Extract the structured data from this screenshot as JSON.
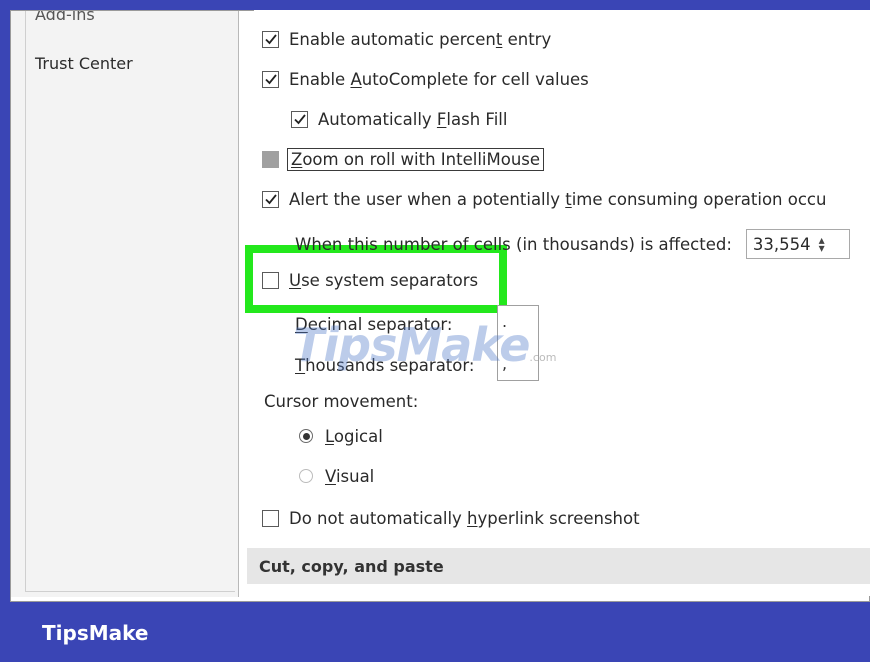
{
  "sidebar": {
    "items": [
      {
        "label": "Add-ins"
      },
      {
        "label": "Trust Center"
      }
    ]
  },
  "options": {
    "percent_entry": {
      "pre": "Enable automatic percen",
      "u": "t",
      "post": " entry",
      "checked": true
    },
    "autocomplete": {
      "pre": "Enable ",
      "u": "A",
      "post": "utoComplete for cell values",
      "checked": true
    },
    "flash_fill": {
      "pre": "Automatically ",
      "u": "F",
      "post": "lash Fill",
      "checked": true
    },
    "zoom_roll": {
      "pre": "",
      "u": "Z",
      "post": "oom on roll with IntelliMouse",
      "checked": false
    },
    "alert": {
      "pre": "Alert the user when a potentially ",
      "u": "t",
      "post": "ime consuming operation occu",
      "checked": true
    },
    "cells_affected": {
      "label": "When this number of cells (in thousands) is affected:",
      "value": "33,554"
    },
    "system_separators": {
      "pre": "",
      "u": "U",
      "post": "se system separators",
      "checked": false
    },
    "decimal_separator": {
      "pre": "",
      "u": "D",
      "post": "ecimal separator:",
      "value": "."
    },
    "thousands_separator": {
      "pre": "",
      "u": "T",
      "post": "housands separator:",
      "value": ","
    },
    "cursor_movement": {
      "label": "Cursor movement:"
    },
    "logical": {
      "u": "L",
      "post": "ogical",
      "selected": true
    },
    "visual": {
      "u": "V",
      "post": "isual",
      "selected": false
    },
    "hyperlink": {
      "pre": "Do not automatically ",
      "u": "h",
      "post": "yperlink screenshot",
      "checked": false
    }
  },
  "section": {
    "title": "Cut, copy, and paste"
  },
  "watermark": {
    "text": "TipsMake",
    "suffix": ".com"
  },
  "brand": {
    "text": "TipsMake"
  },
  "colors": {
    "background": "#3a45b5",
    "highlight": "#23e81c"
  },
  "icons": {
    "check": "checkmark-icon",
    "spinner": "spinner-arrows-icon"
  }
}
